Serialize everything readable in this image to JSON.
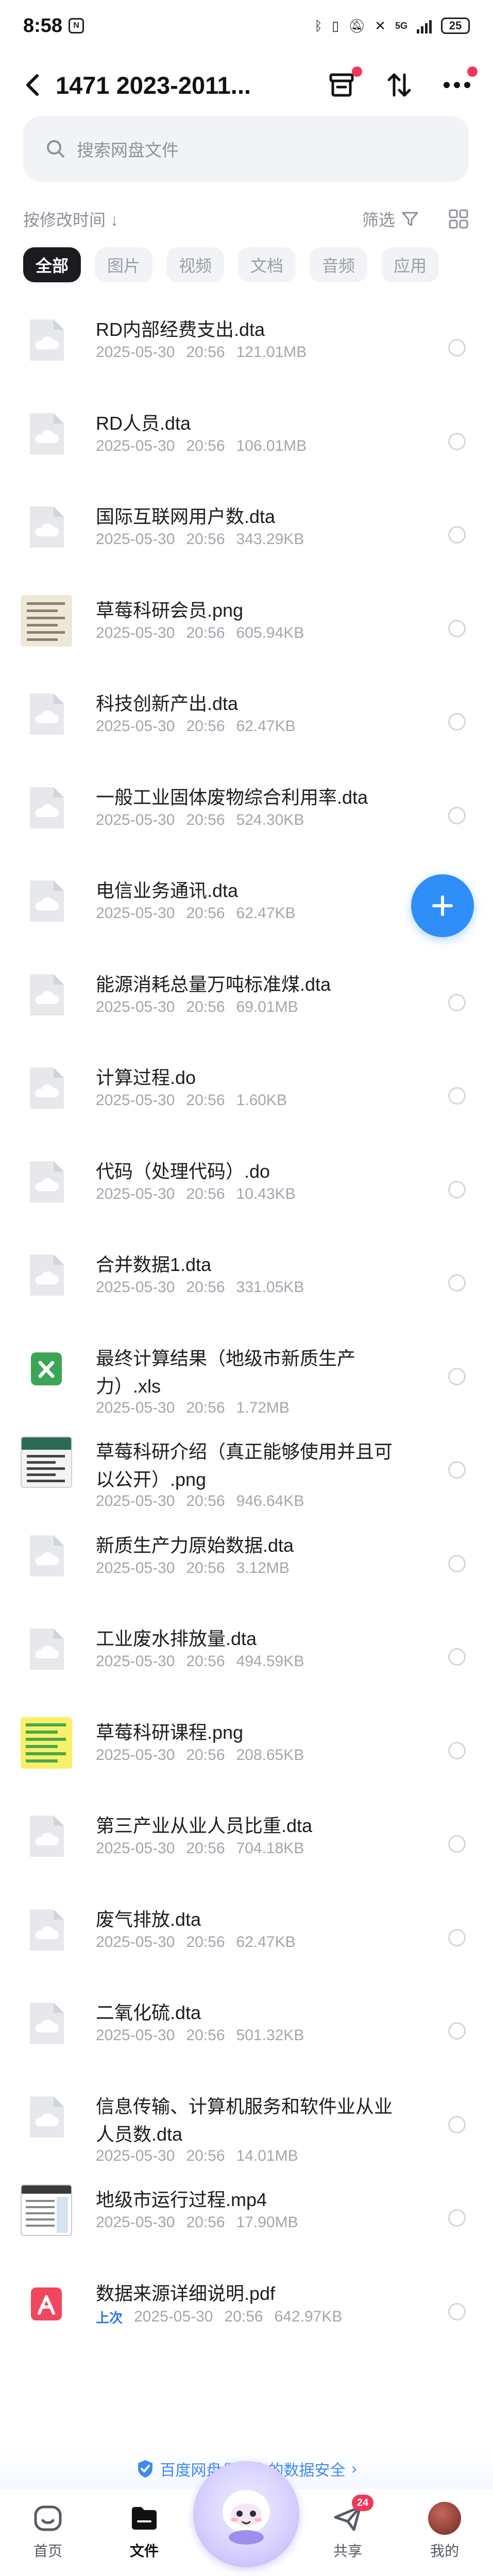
{
  "status_bar": {
    "time": "8:58",
    "network": "5G",
    "battery": "25"
  },
  "header": {
    "title": "1471 2023-2011..."
  },
  "search": {
    "placeholder": "搜索网盘文件"
  },
  "sort": {
    "label": "按修改时间 ↓",
    "filter_label": "筛选"
  },
  "tabs": [
    {
      "label": "全部",
      "active": true
    },
    {
      "label": "图片",
      "active": false
    },
    {
      "label": "视频",
      "active": false
    },
    {
      "label": "文档",
      "active": false
    },
    {
      "label": "音频",
      "active": false
    },
    {
      "label": "应用",
      "active": false
    }
  ],
  "files": [
    {
      "name": "RD内部经费支出.dta",
      "date": "2025-05-30",
      "time": "20:56",
      "size": "121.01MB",
      "icon": "cloud-file-icon"
    },
    {
      "name": "RD人员.dta",
      "date": "2025-05-30",
      "time": "20:56",
      "size": "106.01MB",
      "icon": "cloud-file-icon"
    },
    {
      "name": "国际互联网用户数.dta",
      "date": "2025-05-30",
      "time": "20:56",
      "size": "343.29KB",
      "icon": "cloud-file-icon"
    },
    {
      "name": "草莓科研会员.png",
      "date": "2025-05-30",
      "time": "20:56",
      "size": "605.94KB",
      "icon": "image-thumbnail"
    },
    {
      "name": "科技创新产出.dta",
      "date": "2025-05-30",
      "time": "20:56",
      "size": "62.47KB",
      "icon": "cloud-file-icon"
    },
    {
      "name": "一般工业固体废物综合利用率.dta",
      "date": "2025-05-30",
      "time": "20:56",
      "size": "524.30KB",
      "icon": "cloud-file-icon"
    },
    {
      "name": "电信业务通讯.dta",
      "date": "2025-05-30",
      "time": "20:56",
      "size": "62.47KB",
      "icon": "cloud-file-icon"
    },
    {
      "name": "能源消耗总量万吨标准煤.dta",
      "date": "2025-05-30",
      "time": "20:56",
      "size": "69.01MB",
      "icon": "cloud-file-icon"
    },
    {
      "name": "计算过程.do",
      "date": "2025-05-30",
      "time": "20:56",
      "size": "1.60KB",
      "icon": "cloud-file-icon"
    },
    {
      "name": "代码（处理代码）.do",
      "date": "2025-05-30",
      "time": "20:56",
      "size": "10.43KB",
      "icon": "cloud-file-icon"
    },
    {
      "name": "合并数据1.dta",
      "date": "2025-05-30",
      "time": "20:56",
      "size": "331.05KB",
      "icon": "cloud-file-icon"
    },
    {
      "name": "最终计算结果（地级市新质生产力）.xls",
      "date": "2025-05-30",
      "time": "20:56",
      "size": "1.72MB",
      "icon": "excel-icon"
    },
    {
      "name": "草莓科研介绍（真正能够使用并且可以公开）.png",
      "date": "2025-05-30",
      "time": "20:56",
      "size": "946.64KB",
      "icon": "image-thumbnail"
    },
    {
      "name": "新质生产力原始数据.dta",
      "date": "2025-05-30",
      "time": "20:56",
      "size": "3.12MB",
      "icon": "cloud-file-icon"
    },
    {
      "name": "工业废水排放量.dta",
      "date": "2025-05-30",
      "time": "20:56",
      "size": "494.59KB",
      "icon": "cloud-file-icon"
    },
    {
      "name": "草莓科研课程.png",
      "date": "2025-05-30",
      "time": "20:56",
      "size": "208.65KB",
      "icon": "image-thumbnail"
    },
    {
      "name": "第三产业从业人员比重.dta",
      "date": "2025-05-30",
      "time": "20:56",
      "size": "704.18KB",
      "icon": "cloud-file-icon"
    },
    {
      "name": "废气排放.dta",
      "date": "2025-05-30",
      "time": "20:56",
      "size": "62.47KB",
      "icon": "cloud-file-icon"
    },
    {
      "name": "二氧化硫.dta",
      "date": "2025-05-30",
      "time": "20:56",
      "size": "501.32KB",
      "icon": "cloud-file-icon"
    },
    {
      "name": "信息传输、计算机服务和软件业从业人员数.dta",
      "date": "2025-05-30",
      "time": "20:56",
      "size": "14.01MB",
      "icon": "cloud-file-icon"
    },
    {
      "name": "地级市运行过程.mp4",
      "date": "2025-05-30",
      "time": "20:56",
      "size": "17.90MB",
      "icon": "video-thumbnail"
    },
    {
      "name": "数据来源详细说明.pdf",
      "date": "2025-05-30",
      "time": "20:56",
      "size": "642.97KB",
      "icon": "pdf-icon",
      "tag": "上次"
    }
  ],
  "safety_banner": {
    "text": "百度网盘保障你的数据安全",
    "arrow": "›"
  },
  "bottom_nav": {
    "home": "首页",
    "files": "文件",
    "share": "共享",
    "share_badge": "24",
    "mine": "我的"
  },
  "colors": {
    "accent_blue": "#2f8ef8",
    "badge_red": "#f0385a",
    "tab_active_bg": "#1b1c20"
  }
}
